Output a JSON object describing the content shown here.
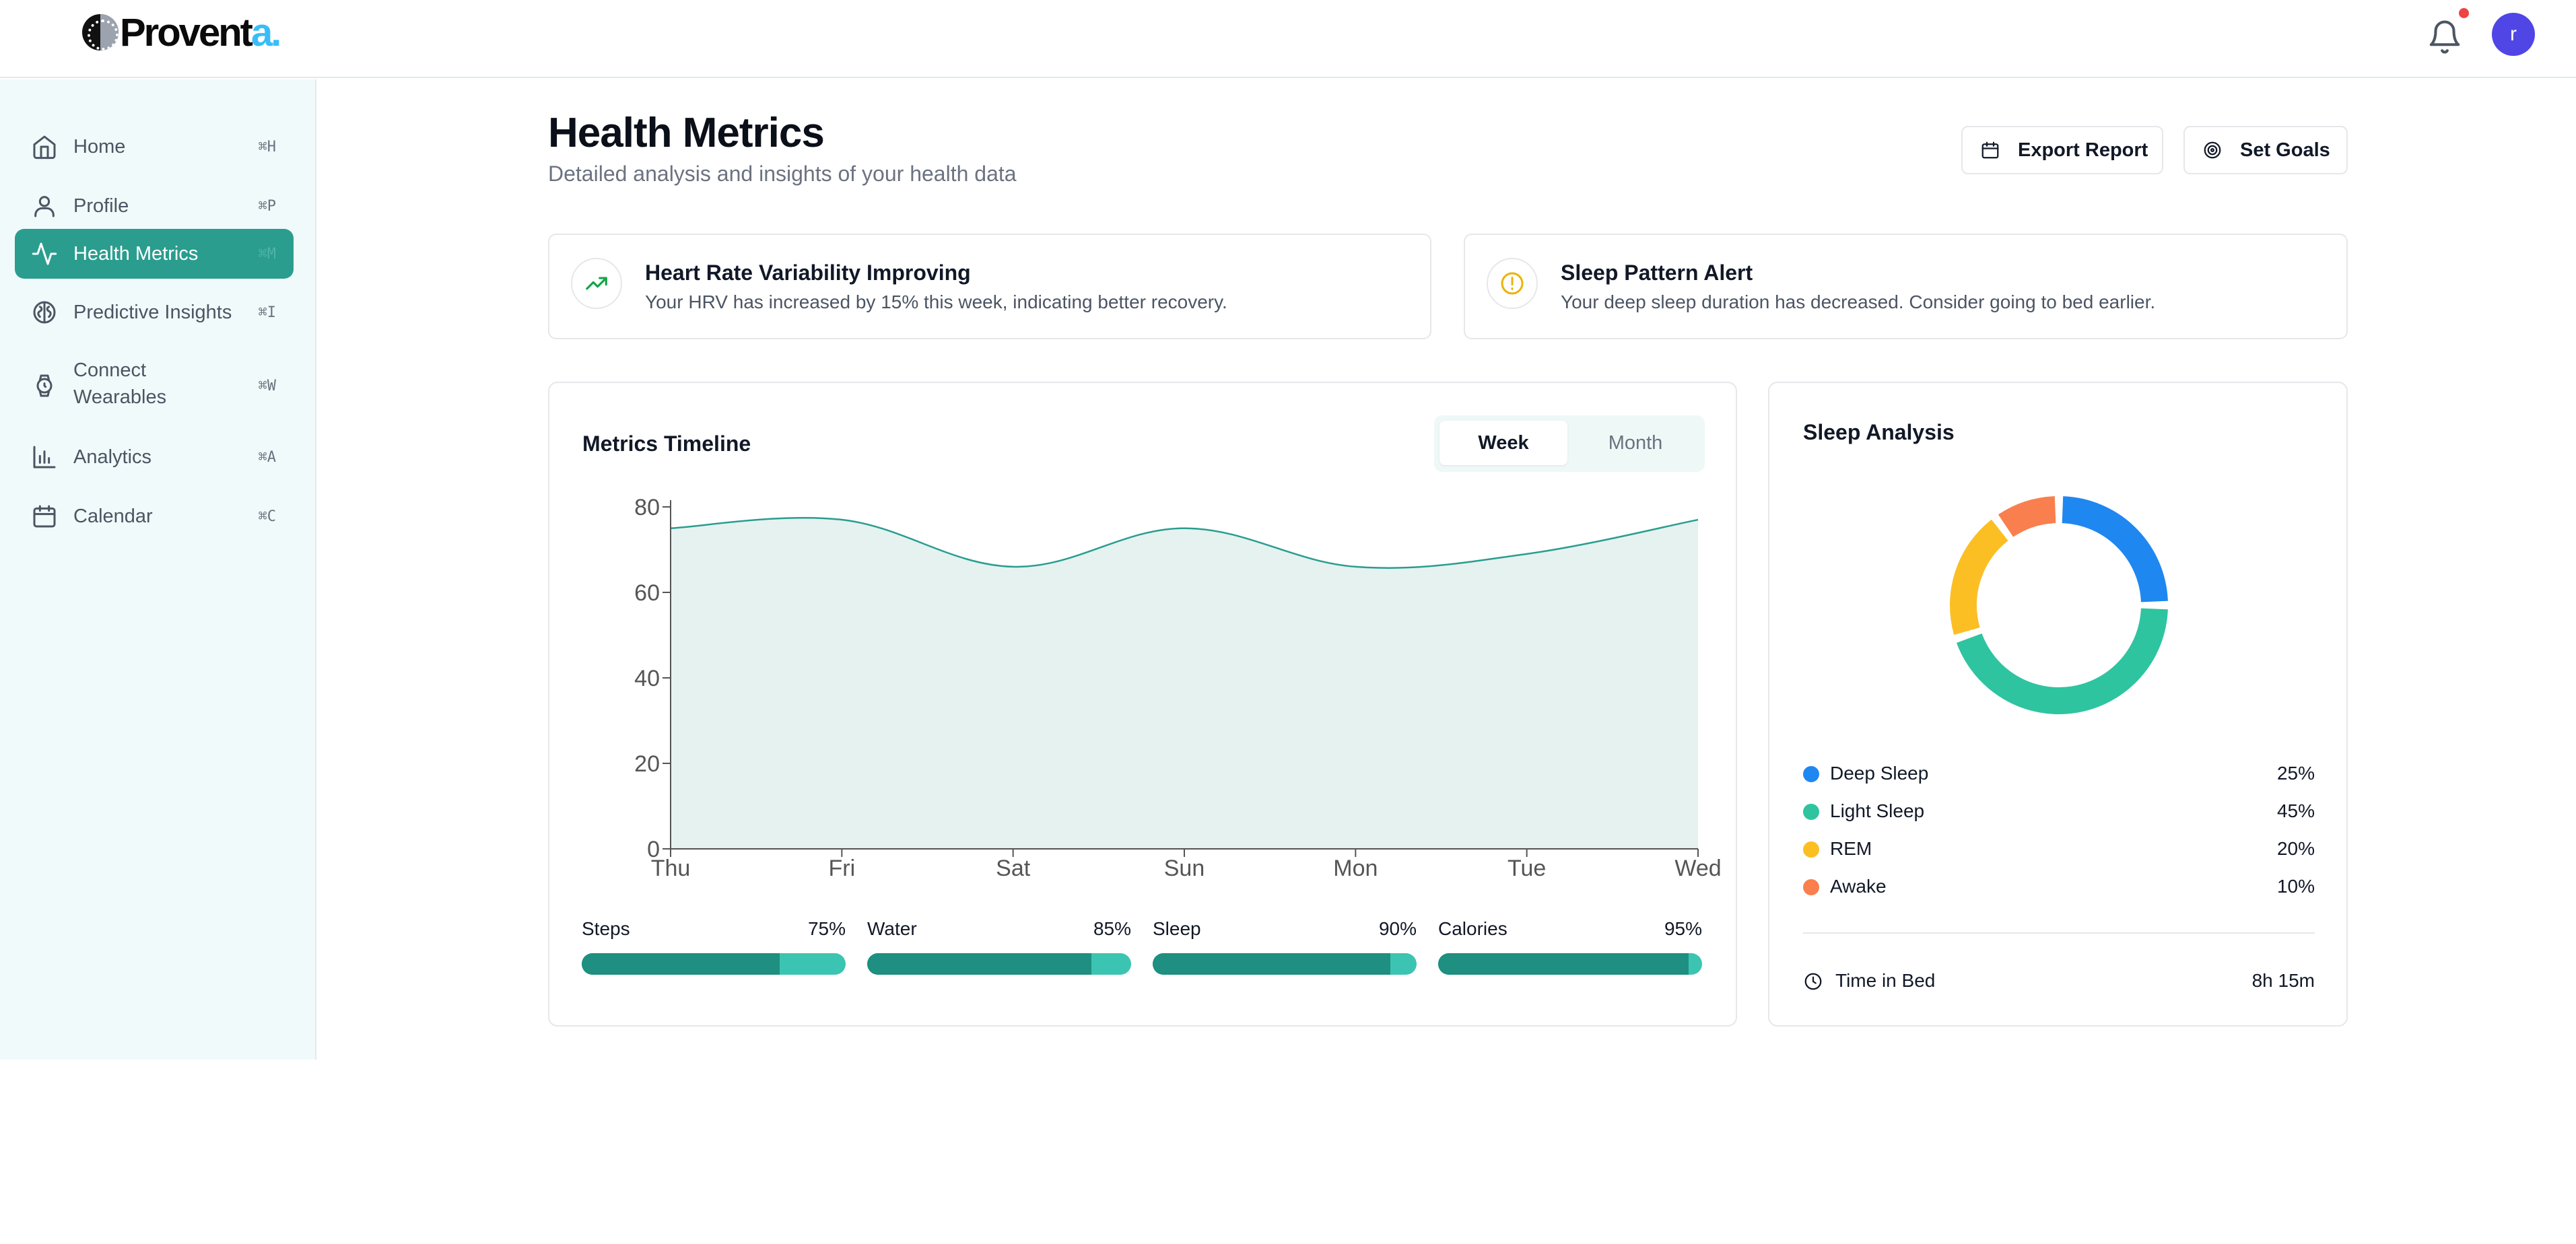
{
  "brand": {
    "name_main": "Provent",
    "name_accent": "a."
  },
  "header": {
    "avatar_initial": "r"
  },
  "sidebar": {
    "items": [
      {
        "label": "Home",
        "shortcut": "⌘H",
        "icon": "home-icon"
      },
      {
        "label": "Profile",
        "shortcut": "⌘P",
        "icon": "user-icon"
      },
      {
        "label": "Health Metrics",
        "shortcut": "⌘M",
        "icon": "activity-icon",
        "active": true
      },
      {
        "label": "Predictive Insights",
        "shortcut": "⌘I",
        "icon": "brain-icon"
      },
      {
        "label": "Connect Wearables",
        "shortcut": "⌘W",
        "icon": "watch-icon"
      },
      {
        "label": "Analytics",
        "shortcut": "⌘A",
        "icon": "bar-chart-icon"
      },
      {
        "label": "Calendar",
        "shortcut": "⌘C",
        "icon": "calendar-icon"
      }
    ]
  },
  "page": {
    "title": "Health Metrics",
    "subtitle": "Detailed analysis and insights of your health data",
    "export_label": "Export Report",
    "goals_label": "Set Goals"
  },
  "alerts": [
    {
      "title": "Heart Rate Variability Improving",
      "message": "Your HRV has increased by 15% this week, indicating better recovery.",
      "icon": "trending-up-icon",
      "color": "#16a34a"
    },
    {
      "title": "Sleep Pattern Alert",
      "message": "Your deep sleep duration has decreased. Consider going to bed earlier.",
      "icon": "alert-circle-icon",
      "color": "#eab308"
    }
  ],
  "timeline": {
    "title": "Metrics Timeline",
    "tabs": [
      {
        "label": "Week",
        "active": true
      },
      {
        "label": "Month",
        "active": false
      }
    ]
  },
  "chart_data": {
    "type": "area",
    "categories": [
      "Thu",
      "Fri",
      "Sat",
      "Sun",
      "Mon",
      "Tue",
      "Wed"
    ],
    "values": [
      75,
      77,
      66,
      75,
      66,
      69,
      77
    ],
    "ylim": [
      0,
      80
    ],
    "yticks": [
      "80",
      "60",
      "40",
      "20",
      "0"
    ],
    "ytick_values": [
      80,
      60,
      40,
      20,
      0
    ],
    "grid": false,
    "line_color": "#2a9d8f",
    "fill_color": "#e5f2f0"
  },
  "progress": [
    {
      "label": "Steps",
      "value_text": "75%",
      "value": 0.75
    },
    {
      "label": "Water",
      "value_text": "85%",
      "value": 0.85
    },
    {
      "label": "Sleep",
      "value_text": "90%",
      "value": 0.9
    },
    {
      "label": "Calories",
      "value_text": "95%",
      "value": 0.95
    }
  ],
  "sleep": {
    "title": "Sleep Analysis",
    "segments": [
      {
        "label": "Deep Sleep",
        "value_text": "25%",
        "value": 25,
        "color": "#1f87f0"
      },
      {
        "label": "Light Sleep",
        "value_text": "45%",
        "value": 45,
        "color": "#2ec4a0"
      },
      {
        "label": "REM",
        "value_text": "20%",
        "value": 20,
        "color": "#fbbf24"
      },
      {
        "label": "Awake",
        "value_text": "10%",
        "value": 10,
        "color": "#f97f4e"
      }
    ],
    "time_in_bed_label": "Time in Bed",
    "time_in_bed_value": "8h 15m"
  }
}
